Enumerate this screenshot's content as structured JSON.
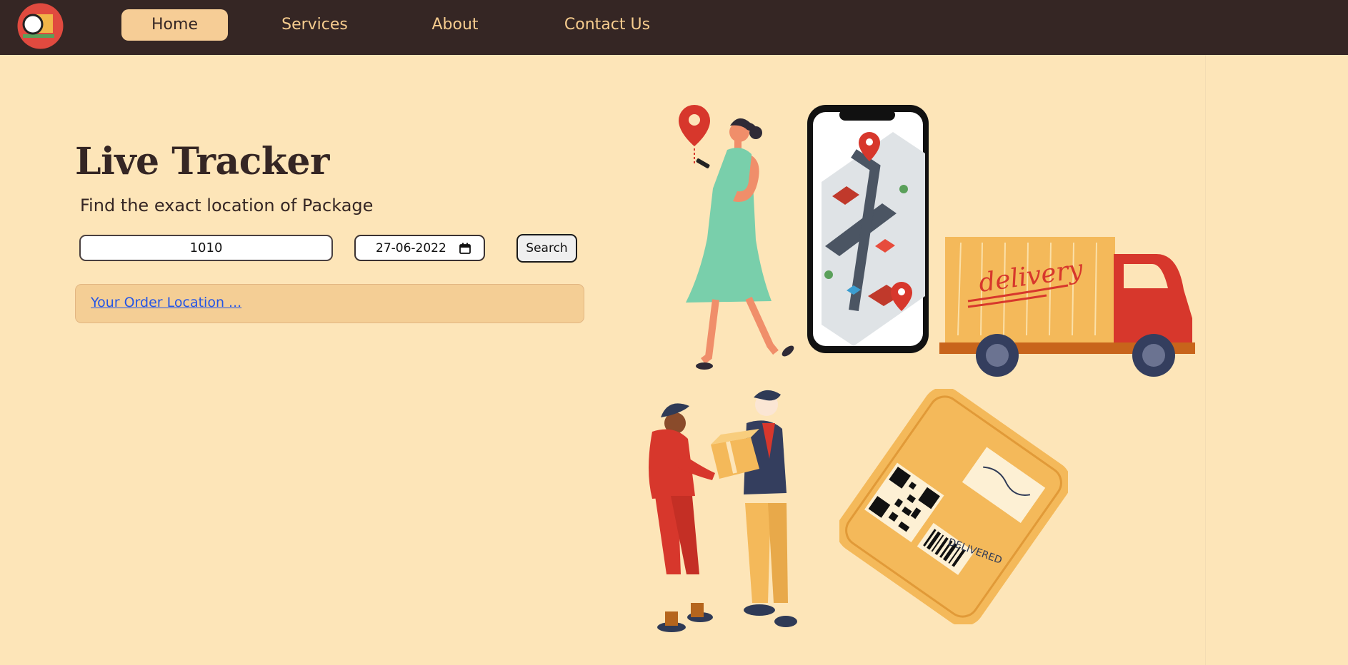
{
  "nav": {
    "items": [
      "Home",
      "Services",
      "About",
      "Contact Us"
    ],
    "active": "Home"
  },
  "hero": {
    "title": "Live Tracker",
    "subtitle": "Find the exact location of Package"
  },
  "form": {
    "order_id_value": "1010",
    "date_value": "27-06-2022",
    "search_label": "Search"
  },
  "result": {
    "link_text": "Your Order Location ..."
  },
  "illustration": {
    "truck_text": "delivery",
    "stamp_text": "DELIVERED"
  },
  "colors": {
    "navbar": "#352624",
    "background": "#fde5b8",
    "accent": "#f6cd96",
    "nav_text": "#f6cc8e"
  }
}
